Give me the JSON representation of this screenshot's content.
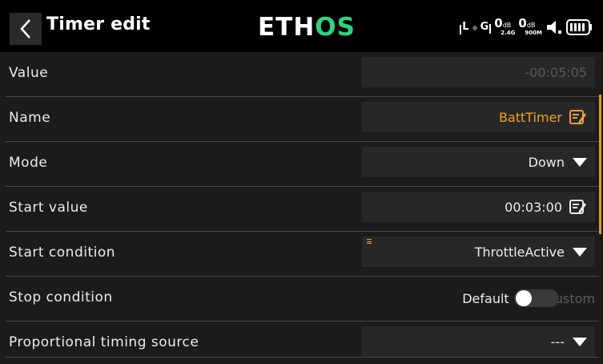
{
  "header": {
    "title": "Timer edit",
    "brand_prefix": "ETH",
    "brand_suffix": "OS",
    "status": {
      "l_label": "L",
      "g_label": "G",
      "rssi_2g4": "0",
      "rssi_2g4_unit": "dB",
      "rssi_2g4_band": "2.4G",
      "rssi_900": "0",
      "rssi_900_unit": "dB",
      "rssi_900_band": "900M"
    }
  },
  "rows": [
    {
      "label": "Value",
      "value": "-00:05:05"
    },
    {
      "label": "Name",
      "value": "BattTimer"
    },
    {
      "label": "Mode",
      "value": "Down"
    },
    {
      "label": "Start value",
      "value": "00:03:00"
    },
    {
      "label": "Start condition",
      "value": "ThrottleActive"
    },
    {
      "label": "Stop condition",
      "option_a": "Default",
      "option_b": "Custom"
    },
    {
      "label": "Proportional timing source",
      "value": "---"
    }
  ],
  "colors": {
    "background": "#1b1b1b",
    "header": "#000000",
    "field": "#272727",
    "accent": "#f0a030",
    "brand_green": "#2ed47a"
  },
  "icons": [
    "back-chevron",
    "edit-icon",
    "dropdown-arrow",
    "speaker-icon",
    "battery-icon"
  ]
}
